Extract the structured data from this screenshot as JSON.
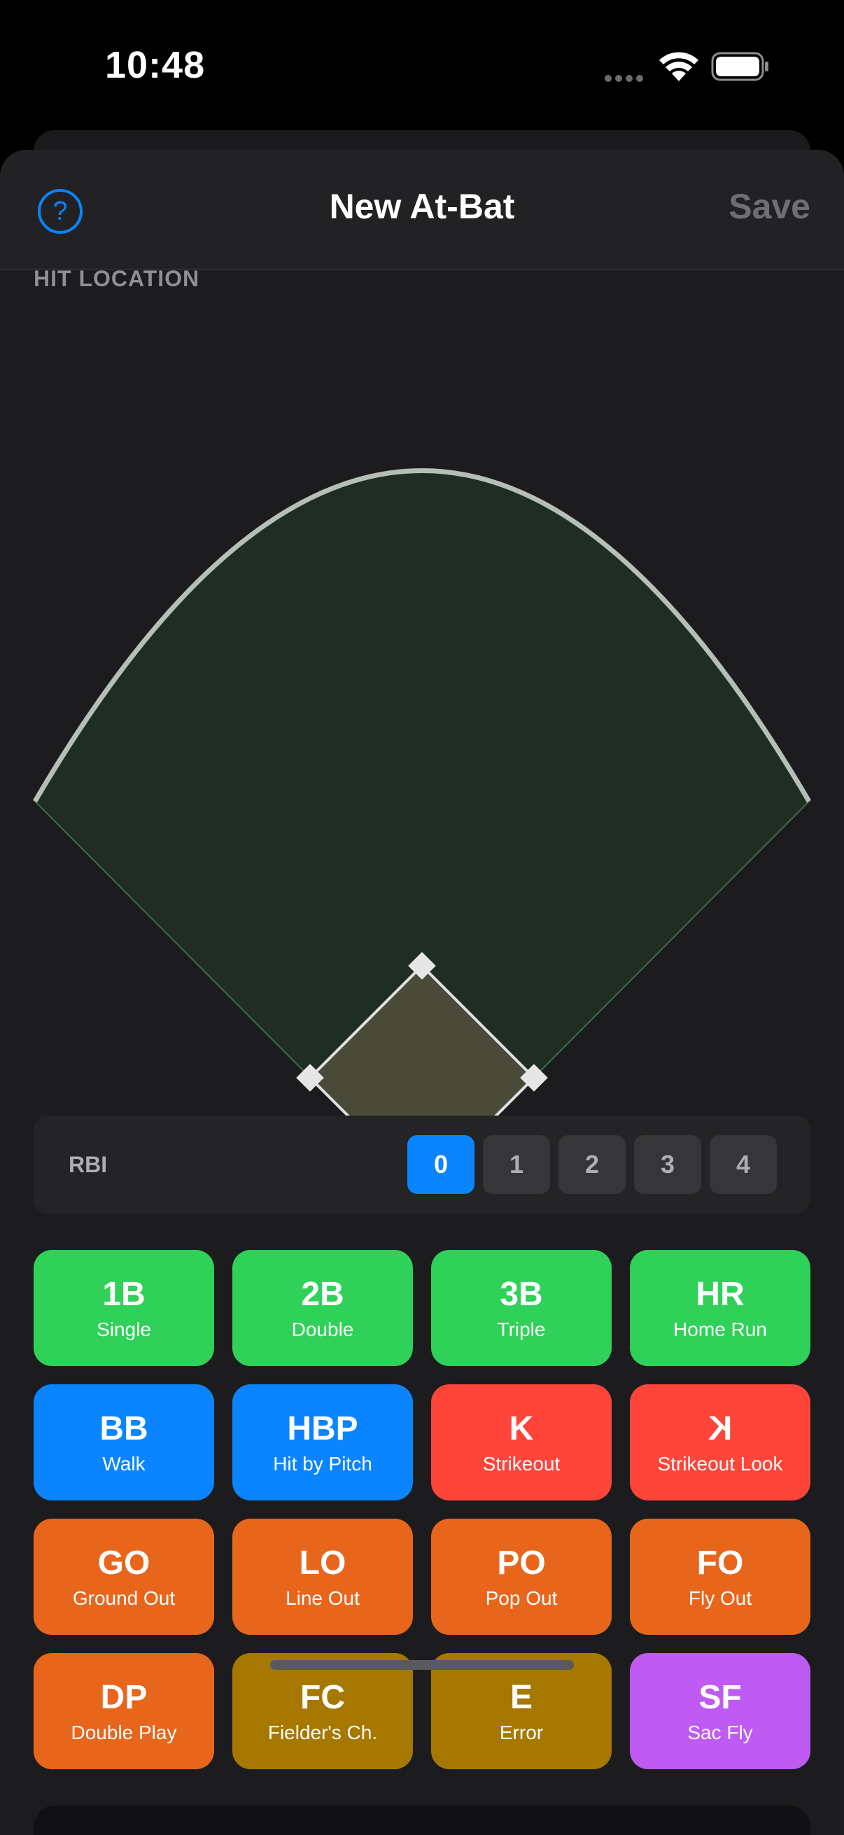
{
  "status_bar": {
    "time": "10:48"
  },
  "nav": {
    "help_glyph": "?",
    "title": "New At-Bat",
    "save_label": "Save"
  },
  "hit_location": {
    "label": "HIT LOCATION"
  },
  "rbi": {
    "label": "RBI",
    "options": [
      "0",
      "1",
      "2",
      "3",
      "4"
    ],
    "selected": "0"
  },
  "outcomes": [
    {
      "code": "1B",
      "label": "Single",
      "color": "#30d158"
    },
    {
      "code": "2B",
      "label": "Double",
      "color": "#30d158"
    },
    {
      "code": "3B",
      "label": "Triple",
      "color": "#30d158"
    },
    {
      "code": "HR",
      "label": "Home Run",
      "color": "#30d158"
    },
    {
      "code": "BB",
      "label": "Walk",
      "color": "#0a84ff"
    },
    {
      "code": "HBP",
      "label": "Hit by Pitch",
      "color": "#0a84ff"
    },
    {
      "code": "K",
      "label": "Strikeout",
      "color": "#ff453a"
    },
    {
      "code": "K",
      "label": "Strikeout Look",
      "color": "#ff453a",
      "mirrored": true
    },
    {
      "code": "GO",
      "label": "Ground Out",
      "color": "#e8661c"
    },
    {
      "code": "LO",
      "label": "Line Out",
      "color": "#e8661c"
    },
    {
      "code": "PO",
      "label": "Pop Out",
      "color": "#e8661c"
    },
    {
      "code": "FO",
      "label": "Fly Out",
      "color": "#e8661c"
    },
    {
      "code": "DP",
      "label": "Double Play",
      "color": "#e8661c"
    },
    {
      "code": "FC",
      "label": "Fielder's Ch.",
      "color": "#a67800"
    },
    {
      "code": "E",
      "label": "Error",
      "color": "#a67800"
    },
    {
      "code": "SF",
      "label": "Sac Fly",
      "color": "#bf5af2"
    }
  ],
  "colors": {
    "accent": "#0a84ff",
    "outfield": "#1f2d24",
    "infield": "#4a4a38",
    "background": "#1c1c1e"
  }
}
